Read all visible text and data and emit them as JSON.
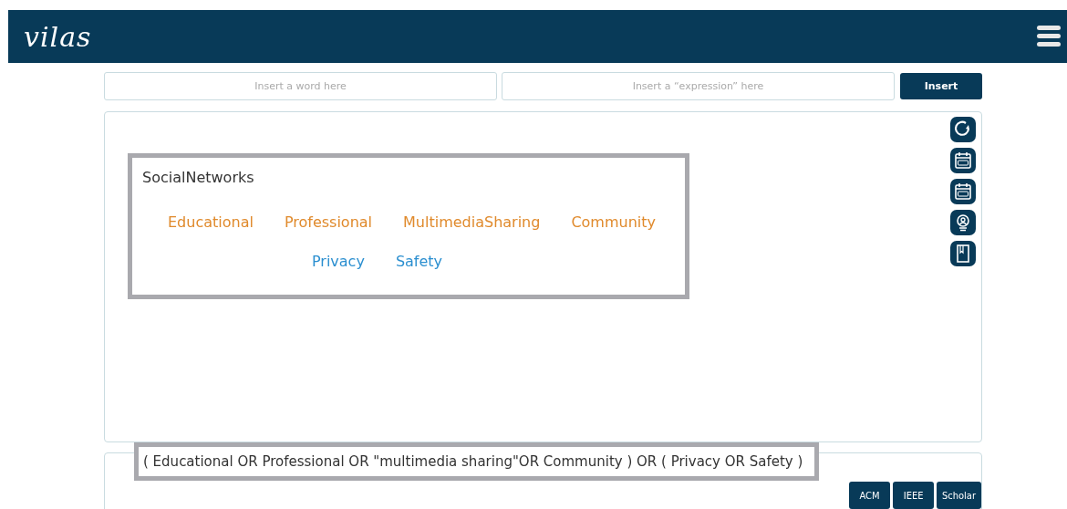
{
  "header": {
    "logo": "vilas"
  },
  "inputs": [
    {
      "placeholder": "Insert a word here"
    },
    {
      "placeholder": "Insert a “expression” here"
    }
  ],
  "insert_button": "Insert",
  "concept": {
    "title": "SocialNetworks",
    "groups": [
      {
        "terms": [
          {
            "label": "Educational",
            "color": "#e08a2c"
          },
          {
            "label": "Professional",
            "color": "#e08a2c"
          },
          {
            "label": "MultimediaSharing",
            "color": "#e08a2c"
          },
          {
            "label": "Community",
            "color": "#e08a2c"
          }
        ]
      },
      {
        "terms": [
          {
            "label": "Privacy",
            "color": "#2b8fd0"
          },
          {
            "label": "Safety",
            "color": "#2b8fd0"
          }
        ]
      }
    ]
  },
  "tools": [
    {
      "kind": "refresh"
    },
    {
      "kind": "year-from"
    },
    {
      "kind": "year-to"
    },
    {
      "kind": "author"
    },
    {
      "kind": "book"
    }
  ],
  "query": "( Educational OR Professional OR \"multimedia sharing\"OR Community ) OR ( Privacy OR Safety )",
  "sources": [
    "ACM",
    "IEEE",
    "Scholar"
  ]
}
